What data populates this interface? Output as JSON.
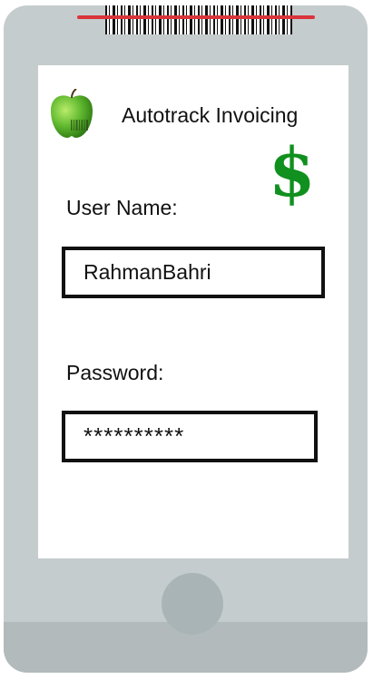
{
  "app": {
    "title": "Autotrack Invoicing"
  },
  "icons": {
    "logo": "green-apple-barcode-icon",
    "currency": "dollar-sign-icon",
    "currency_glyph": "$"
  },
  "login": {
    "username_label": "User Name:",
    "username_value": "RahmanBahri",
    "password_label": "Password:",
    "password_value": "**********"
  },
  "colors": {
    "phone_body": "#c5cccd",
    "scan_line": "#d9343a",
    "dollar": "#10901e",
    "apple": "#5fb82e"
  }
}
